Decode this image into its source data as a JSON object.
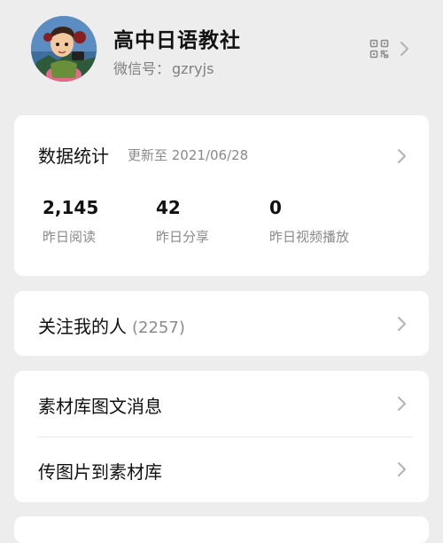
{
  "profile": {
    "name": "高中日语教社",
    "wechat_id_label": "微信号：",
    "wechat_id": "gzryjs"
  },
  "stats": {
    "title": "数据统计",
    "updated": "更新至 2021/06/28",
    "items": [
      {
        "value": "2,145",
        "label": "昨日阅读"
      },
      {
        "value": "42",
        "label": "昨日分享"
      },
      {
        "value": "0",
        "label": "昨日视频播放"
      }
    ]
  },
  "followers": {
    "label": "关注我的人",
    "count": "(2257)"
  },
  "materials": {
    "items": [
      {
        "label": "素材库图文消息"
      },
      {
        "label": "传图片到素材库"
      }
    ]
  },
  "icons": {
    "qr": "qr-code-icon",
    "chevron": "chevron-right-icon"
  },
  "colors": {
    "background": "#ededed",
    "card": "#ffffff",
    "secondary_text": "#8a8a8a"
  }
}
